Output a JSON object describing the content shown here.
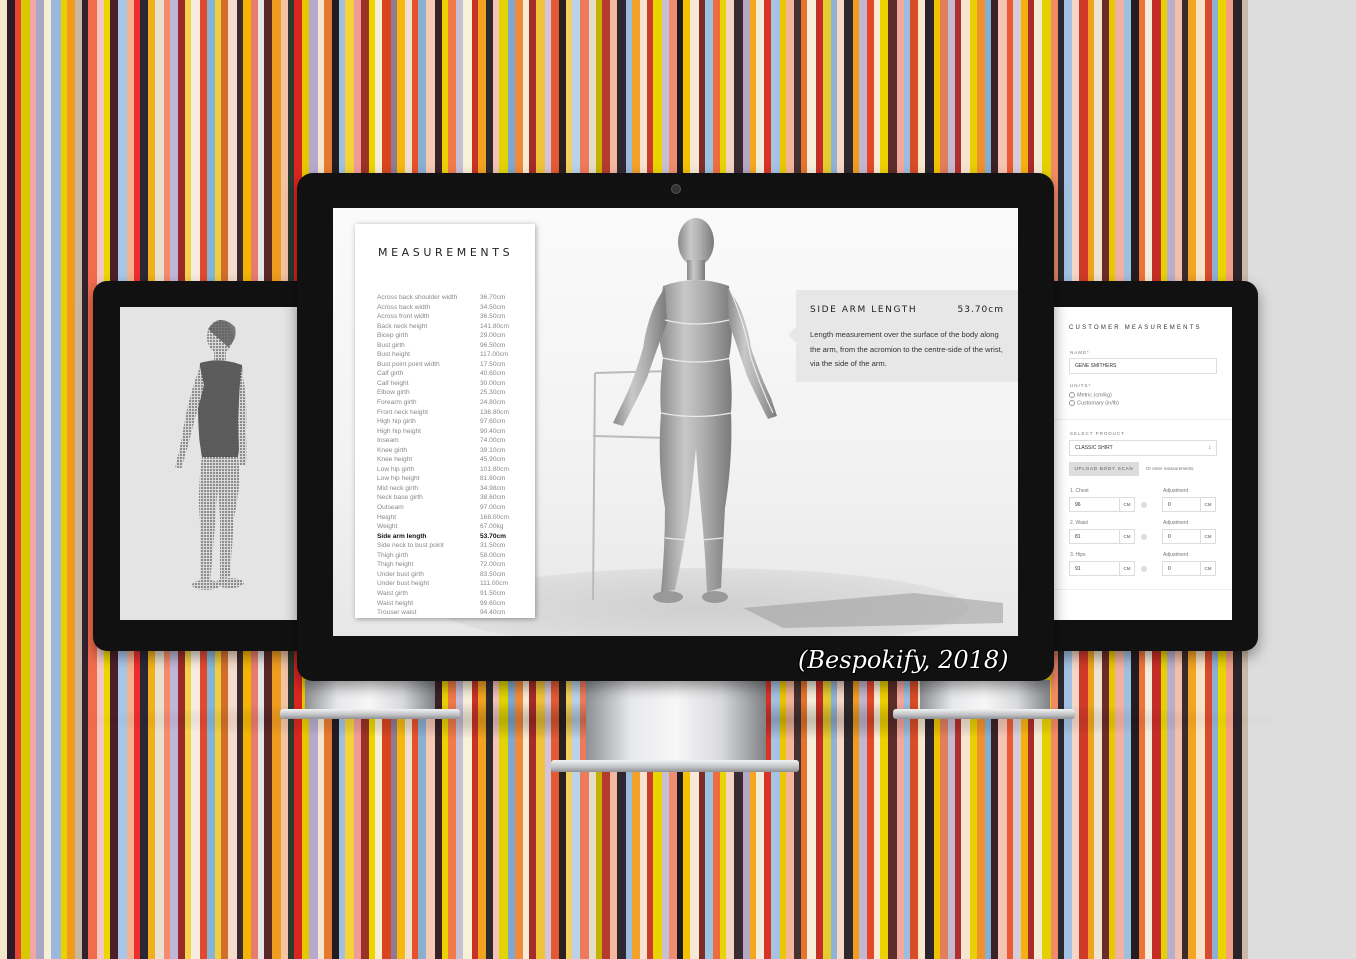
{
  "background": {
    "stripe_colors": [
      "#f3e8c9",
      "#2b1b2a",
      "#e8462f",
      "#d7c800",
      "#f0a8a6",
      "#a9a6c8",
      "#f6efd2",
      "#9ab7e0",
      "#e7d200",
      "#f19a1c",
      "#c9b8a0",
      "#332331",
      "#f26b4d",
      "#f5c7c0",
      "#e8d700",
      "#4b1e2a",
      "#a8c6ea",
      "#f6b18e",
      "#ee2e2f",
      "#2b2734",
      "#f0b11a",
      "#e8e0d0",
      "#f58a6e",
      "#c0b7d6",
      "#9b2b2a",
      "#f4d24a",
      "#f8ece2",
      "#e14a2e",
      "#86b4d6",
      "#efcf3c",
      "#d36e2a",
      "#f7dccb",
      "#3b2a2e",
      "#f4b500",
      "#e77b6c",
      "#e6e6ea",
      "#5a2824",
      "#ef9d21",
      "#f3c4a4",
      "#2d3a2e",
      "#d9261f",
      "#e6c800",
      "#b6a9cd",
      "#f7e6ce",
      "#e57a2e",
      "#221c23",
      "#a1c0e4",
      "#f2d43a",
      "#f19a9c",
      "#9a3225",
      "#edd500",
      "#f6eed5",
      "#d8451f",
      "#8f7c94",
      "#f4b80f",
      "#efe1cd",
      "#e8502a",
      "#8ab0d0",
      "#f6c9b6",
      "#392126",
      "#ecd100",
      "#f07b49",
      "#c7bfd6",
      "#f9f0d8",
      "#c93224",
      "#f1a320",
      "#2d2a2e",
      "#f2c2bb",
      "#e2d400",
      "#7ea8cf",
      "#f08b3b",
      "#f9ecd6",
      "#a52c28",
      "#efc23a",
      "#d0c5dc",
      "#e45a30",
      "#2a2020",
      "#f3d160",
      "#b8d3ea",
      "#ef7a5b",
      "#e5ddc5",
      "#c8b000",
      "#b63a2e",
      "#f4b8a0",
      "#302830",
      "#9dbbde",
      "#f2a12a",
      "#f7e3cf",
      "#cc3d2b",
      "#ead400",
      "#c8c0d0",
      "#f08d70",
      "#1f1a1e",
      "#f3c100",
      "#f6e9d8",
      "#7f2d27",
      "#9cc3e1",
      "#ef6d3c",
      "#e6d500",
      "#f6d2c3",
      "#3a2a32",
      "#b5a8c7",
      "#f5a61b",
      "#f2ecde",
      "#d83325",
      "#a6c3e2",
      "#eac700",
      "#f4b59a",
      "#463232",
      "#e7742c",
      "#f5eedb",
      "#c53026",
      "#e3cc2f",
      "#8fb3d7",
      "#f8d8c8",
      "#2e2a2e",
      "#f19b1f",
      "#c2b6d2",
      "#e5472a",
      "#f7eed6",
      "#efd000",
      "#5d2d2a",
      "#f3a89d",
      "#9bbddf",
      "#d94c27",
      "#f8e8c9",
      "#2b232c",
      "#f1c200",
      "#e07e5e",
      "#c4bad0",
      "#b2302b",
      "#f6e5d2",
      "#e8cf00",
      "#f0912d",
      "#87aed3",
      "#3b2226",
      "#f6c4b5",
      "#ec5b35",
      "#d7cdd9",
      "#f4b10f",
      "#a82d27",
      "#f4ebd6",
      "#e4d000",
      "#f28a67",
      "#2c2830",
      "#a3c1e2",
      "#f5d7c8",
      "#cf3a28",
      "#efa31f",
      "#eee4cf",
      "#6b2b28",
      "#e8c600",
      "#f2b0a0",
      "#9ec0df",
      "#231d22",
      "#ef7438",
      "#f6ebdc",
      "#c42d26",
      "#e6d100",
      "#b8adcb",
      "#f5c0a8",
      "#3d2a2e",
      "#f2a423",
      "#f7e2c8",
      "#da4a2c",
      "#8cb0d2",
      "#ecd400",
      "#f39e87",
      "#2a2428",
      "#c8b9a8"
    ],
    "stripe_widths": [
      7,
      8,
      6,
      9,
      6,
      8,
      7,
      10,
      6,
      8,
      7,
      6,
      9,
      7,
      6,
      8,
      9,
      7,
      6,
      8,
      7,
      9,
      6,
      8,
      7,
      6,
      9,
      7,
      8,
      6,
      7,
      9,
      6,
      8,
      7,
      6,
      8,
      9,
      7,
      6,
      8,
      7,
      9,
      6,
      8,
      7,
      6,
      9,
      7,
      8,
      6,
      7,
      9,
      6,
      8,
      7,
      6,
      8,
      9,
      7,
      6,
      8,
      7,
      9,
      6,
      8,
      7,
      6,
      9,
      7,
      8,
      6,
      7,
      9,
      6,
      8,
      7,
      6,
      8,
      9,
      7,
      6,
      8,
      7,
      9,
      6,
      8,
      7,
      6,
      9,
      7,
      8,
      6,
      7,
      9,
      6,
      8,
      7,
      6,
      8,
      9,
      7,
      6,
      8,
      7,
      9,
      6,
      8,
      7,
      6,
      9,
      7,
      8,
      6,
      7,
      9,
      6,
      8,
      7,
      6,
      8,
      9,
      7,
      6,
      8,
      7,
      9,
      6,
      8,
      7,
      6,
      9,
      7,
      8,
      6,
      7,
      9,
      6,
      8,
      7,
      6,
      8,
      9,
      7,
      6,
      8,
      7,
      9,
      6,
      8,
      7,
      6,
      9,
      7,
      8,
      6,
      7,
      9,
      6,
      8,
      7,
      6,
      8,
      9,
      7,
      6,
      8,
      7,
      9,
      6,
      8,
      7,
      6,
      9,
      7,
      8,
      6,
      7,
      9,
      6,
      8,
      7,
      6
    ]
  },
  "main_screen": {
    "measurements_title": "MEASUREMENTS",
    "measurements": [
      {
        "name": "Across back shoulder width",
        "value": "36.70cm"
      },
      {
        "name": "Across back width",
        "value": "34.50cm"
      },
      {
        "name": "Across front width",
        "value": "36.50cm"
      },
      {
        "name": "Back neck height",
        "value": "141.80cm"
      },
      {
        "name": "Bicep girth",
        "value": "29.00cm"
      },
      {
        "name": "Bust girth",
        "value": "96.50cm"
      },
      {
        "name": "Bust height",
        "value": "117.00cm"
      },
      {
        "name": "Bust point point width",
        "value": "17.50cm"
      },
      {
        "name": "Calf girth",
        "value": "40.60cm"
      },
      {
        "name": "Calf height",
        "value": "30.00cm"
      },
      {
        "name": "Elbow girth",
        "value": "25.30cm"
      },
      {
        "name": "Forearm girth",
        "value": "24.80cm"
      },
      {
        "name": "Front neck height",
        "value": "136.80cm"
      },
      {
        "name": "High hip girth",
        "value": "97.60cm"
      },
      {
        "name": "High hip height",
        "value": "90.40cm"
      },
      {
        "name": "Inseam",
        "value": "74.00cm"
      },
      {
        "name": "Knee girth",
        "value": "39.10cm"
      },
      {
        "name": "Knee height",
        "value": "45.90cm"
      },
      {
        "name": "Low hip girth",
        "value": "101.80cm"
      },
      {
        "name": "Low hip height",
        "value": "81.60cm"
      },
      {
        "name": "Mid neck girth",
        "value": "34.98cm"
      },
      {
        "name": "Neck base girth",
        "value": "38.60cm"
      },
      {
        "name": "Outseam",
        "value": "97.00cm"
      },
      {
        "name": "Height",
        "value": "168.00cm"
      },
      {
        "name": "Weight",
        "value": "67.00kg"
      },
      {
        "name": "Side arm length",
        "value": "53.70cm",
        "active": true
      },
      {
        "name": "Side neck to bust point",
        "value": "31.50cm"
      },
      {
        "name": "Thigh girth",
        "value": "58.00cm"
      },
      {
        "name": "Thigh height",
        "value": "72.00cm"
      },
      {
        "name": "Under bust girth",
        "value": "83.50cm"
      },
      {
        "name": "Under bust height",
        "value": "111.00cm"
      },
      {
        "name": "Waist girth",
        "value": "91.50cm"
      },
      {
        "name": "Waist height",
        "value": "99.60cm"
      },
      {
        "name": "Trouser waist",
        "value": "94.40cm"
      }
    ],
    "callout": {
      "title": "SIDE ARM LENGTH",
      "value": "53.70cm",
      "description": "Length measurement over the surface of the body along the arm, from the acromion to the centre-side of the wrist, via the side of the arm."
    }
  },
  "right_screen": {
    "title": "CUSTOMER MEASUREMENTS",
    "name_label": "NAME*",
    "name_value": "GENE SMITHERS",
    "units_label": "UNITS*",
    "unit_options": [
      "Metric (cm/kg)",
      "Customary (in/lb)"
    ],
    "product_label": "SELECT PRODUCT",
    "product_value": "CLASSIC SHIRT",
    "upload_button": "UPLOAD BODY SCAN",
    "or_text": "Or enter measurements",
    "rows": [
      {
        "label": "1. Chest",
        "value": "96",
        "unit": "CM",
        "adj_label": "Adjustment",
        "adj_value": "0",
        "adj_unit": "CM"
      },
      {
        "label": "2. Waist",
        "value": "81",
        "unit": "CM",
        "adj_label": "Adjustment",
        "adj_value": "0",
        "adj_unit": "CM"
      },
      {
        "label": "3. Hips",
        "value": "91",
        "unit": "CM",
        "adj_label": "Adjustment",
        "adj_value": "0",
        "adj_unit": "CM"
      }
    ]
  },
  "caption": "(Bespokify, 2018)"
}
